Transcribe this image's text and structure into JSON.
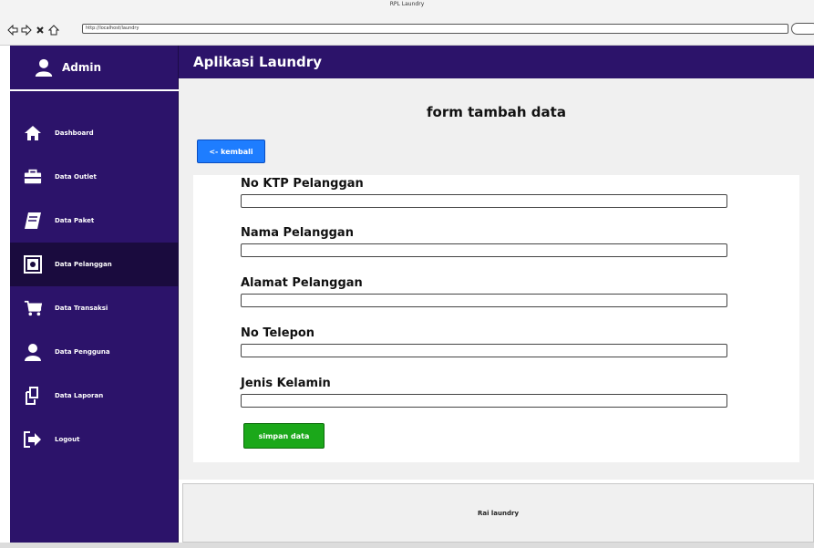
{
  "window": {
    "title": "RPL Laundry",
    "url": "http://localhost/laundry"
  },
  "sidebar": {
    "profile_name": "Admin",
    "items": [
      {
        "label": "Dashboard",
        "icon": "home-icon"
      },
      {
        "label": "Data Outlet",
        "icon": "briefcase-icon"
      },
      {
        "label": "Data Paket",
        "icon": "book-icon"
      },
      {
        "label": "Data Pelanggan",
        "icon": "safe-icon"
      },
      {
        "label": "Data Transaksi",
        "icon": "cart-icon"
      },
      {
        "label": "Data Pengguna",
        "icon": "user-icon"
      },
      {
        "label": "Data Laporan",
        "icon": "copy-icon"
      },
      {
        "label": "Logout",
        "icon": "logout-icon"
      }
    ],
    "active_item": "Data Pelanggan"
  },
  "header": {
    "app_title": "Aplikasi Laundry"
  },
  "main": {
    "form_title": "form tambah data",
    "back_label": "<- kembali",
    "fields": [
      {
        "label": "No KTP Pelanggan",
        "value": ""
      },
      {
        "label": "Nama Pelanggan",
        "value": ""
      },
      {
        "label": "Alamat Pelanggan",
        "value": ""
      },
      {
        "label": "No Telepon",
        "value": ""
      },
      {
        "label": "Jenis Kelamin",
        "value": ""
      }
    ],
    "save_label": "simpan data"
  },
  "footer": {
    "text": "Rai laundry"
  },
  "colors": {
    "sidebar": "#2c136a",
    "sidebar_active": "#1a0b3e",
    "primary_button": "#1e7dff",
    "success_button": "#1ba81a"
  }
}
